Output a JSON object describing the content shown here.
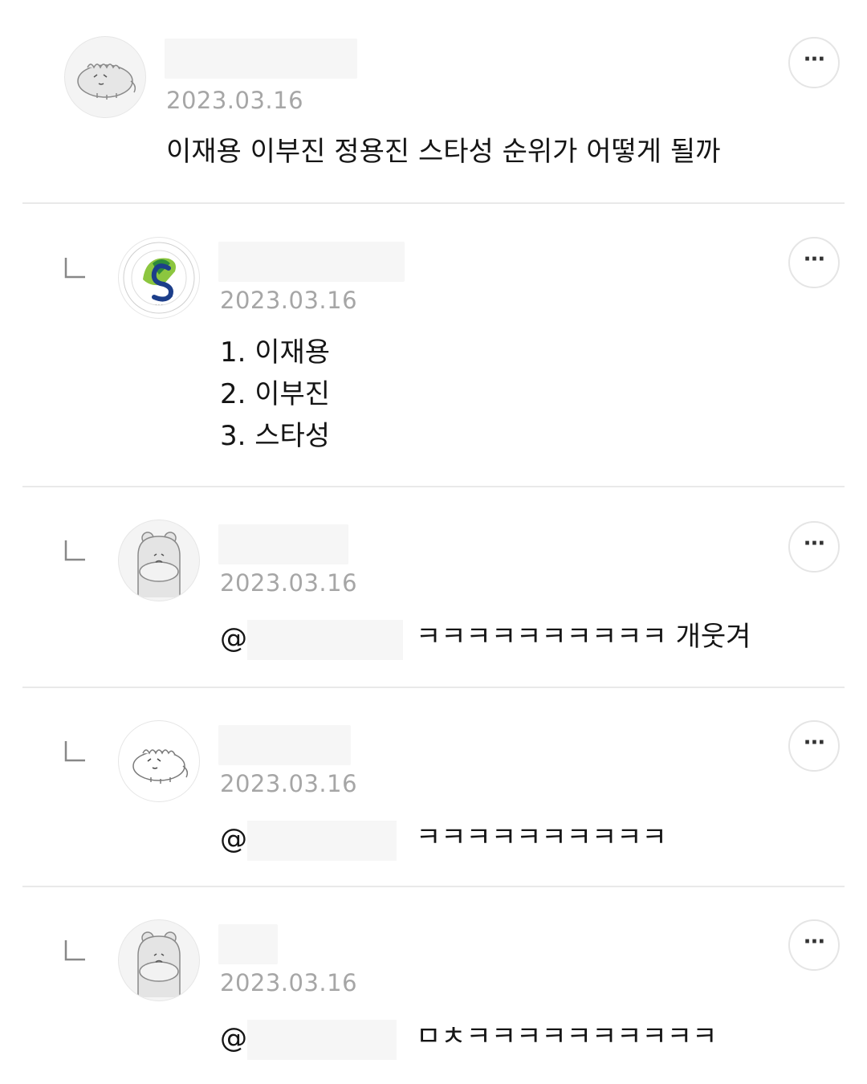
{
  "comments": [
    {
      "date": "2023.03.16",
      "text": "이재용 이부진 정용진 스타성 순위가 어떻게 될까",
      "avatar_icon": "dinosaur-avatar-icon",
      "more_label": "···"
    },
    {
      "date": "2023.03.16",
      "lines": [
        "1. 이재용",
        "2. 이부진",
        "3. 스타성"
      ],
      "avatar_icon": "university-logo-icon",
      "more_label": "···"
    },
    {
      "date": "2023.03.16",
      "mention": "@",
      "text": "ㅋㅋㅋㅋㅋㅋㅋㅋㅋㅋ 개웃겨",
      "avatar_icon": "hamster-avatar-icon",
      "more_label": "···"
    },
    {
      "date": "2023.03.16",
      "mention": "@",
      "text": "ㅋㅋㅋㅋㅋㅋㅋㅋㅋㅋ",
      "avatar_icon": "dinosaur-avatar-icon",
      "more_label": "···"
    },
    {
      "date": "2023.03.16",
      "mention": "@",
      "text": "ㅁㅊㅋㅋㅋㅋㅋㅋㅋㅋㅋㅋ",
      "avatar_icon": "hamster-avatar-icon",
      "more_label": "···"
    }
  ]
}
